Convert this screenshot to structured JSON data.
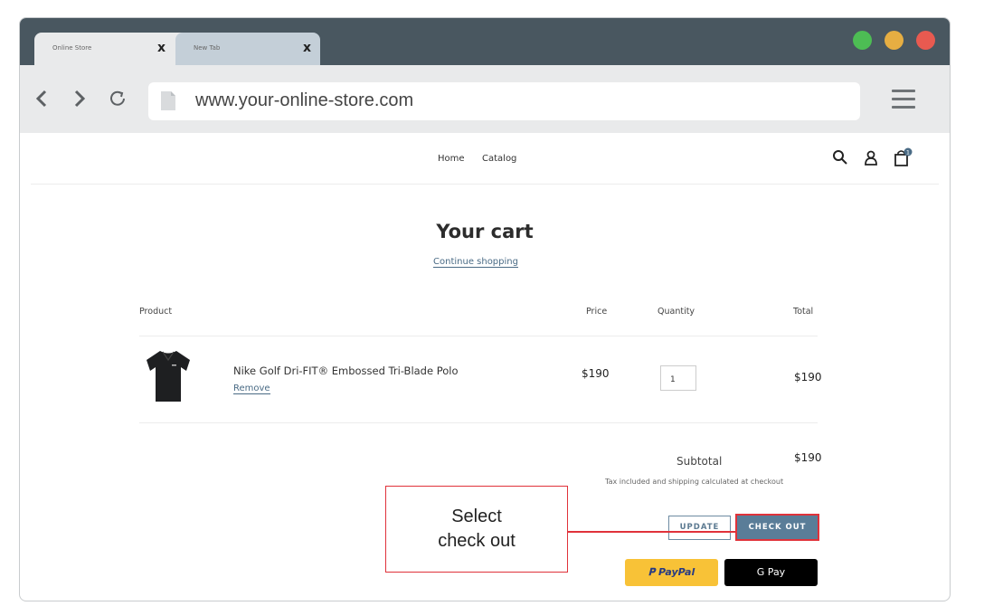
{
  "browser": {
    "tabs": [
      {
        "label": "Online Store",
        "close": "x"
      },
      {
        "label": "New Tab",
        "close": "x"
      }
    ],
    "url": "www.your-online-store.com",
    "window_dots": {
      "green": "#4dbd54",
      "yellow": "#e6ae42",
      "red": "#e85a50"
    }
  },
  "site": {
    "nav": {
      "home": "Home",
      "catalog": "Catalog"
    },
    "cart_count": "1"
  },
  "cart": {
    "title": "Your cart",
    "continue_shopping": "Continue shopping",
    "headers": {
      "product": "Product",
      "price": "Price",
      "quantity": "Quantity",
      "total": "Total"
    },
    "items": [
      {
        "name": "Nike Golf Dri-FIT® Embossed Tri-Blade Polo",
        "remove": "Remove",
        "price": "$190",
        "quantity": "1",
        "total": "$190"
      }
    ],
    "subtotal_label": "Subtotal",
    "subtotal_value": "$190",
    "tax_note": "Tax included and shipping calculated at checkout",
    "update_label": "UPDATE",
    "checkout_label": "CHECK OUT",
    "paypal_label": "PayPal",
    "gpay_label": "G Pay"
  },
  "annotation": {
    "line1": "Select",
    "line2": "check out"
  },
  "colors": {
    "accent": "#5a7d98",
    "highlight": "#e0323a",
    "paypal": "#f8c237"
  }
}
